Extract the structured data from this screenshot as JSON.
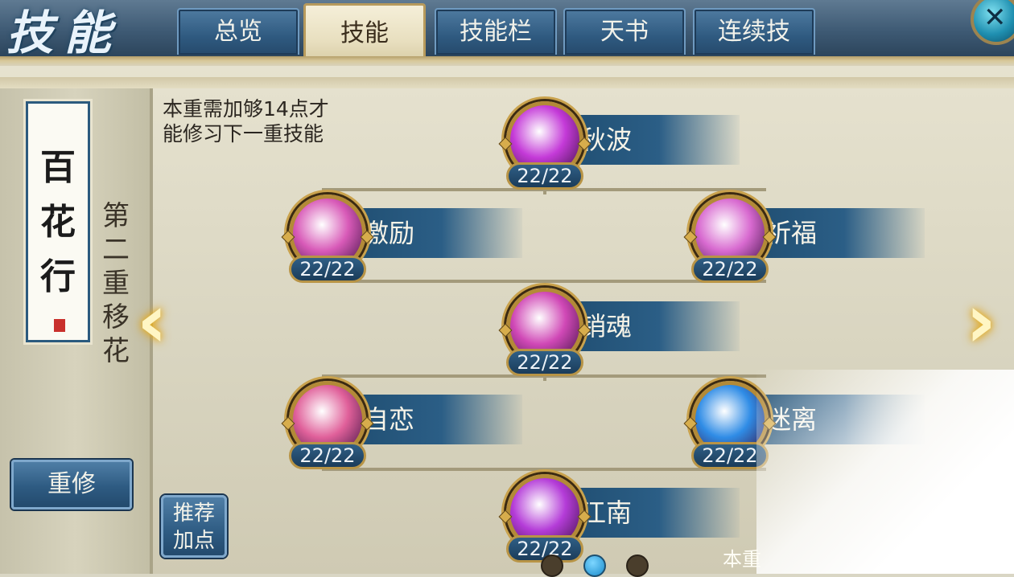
{
  "window": {
    "title": "技能",
    "close_icon": "x-close-icon"
  },
  "tabs": [
    {
      "label": "总览",
      "active": false
    },
    {
      "label": "技能",
      "active": true
    },
    {
      "label": "技能栏",
      "active": false
    },
    {
      "label": "天书",
      "active": false
    },
    {
      "label": "连续技",
      "active": false
    }
  ],
  "sidebar": {
    "sect_name": "百花行",
    "layer_title": "第二重移花",
    "reset_label": "重修",
    "recommend_label_line1": "推荐",
    "recommend_label_line2": "加点"
  },
  "requirement_note": {
    "line1": "本重需加够14点才",
    "line2": "能修习下一重技能"
  },
  "skills": [
    {
      "name": "秋波",
      "level": "22/22",
      "icon": "magenta-crescent-icon",
      "color": "#c43ad8"
    },
    {
      "name": "激励",
      "level": "22/22",
      "icon": "pink-ornate-icon",
      "color": "#d85ab8"
    },
    {
      "name": "祈福",
      "level": "22/22",
      "icon": "lotus-icon",
      "color": "#d86ad0"
    },
    {
      "name": "销魂",
      "level": "22/22",
      "icon": "pink-swirl-icon",
      "color": "#d048b6"
    },
    {
      "name": "自恋",
      "level": "22/22",
      "icon": "pink-shield-icon",
      "color": "#e0609a"
    },
    {
      "name": "迷离",
      "level": "22/22",
      "icon": "blue-shield-icon",
      "color": "#2f8ce6"
    },
    {
      "name": "江南",
      "level": "22/22",
      "icon": "violet-burst-icon",
      "color": "#b43cd8"
    }
  ],
  "pagination": {
    "pages": 3,
    "current": 2
  },
  "next_page_peek": "本重"
}
